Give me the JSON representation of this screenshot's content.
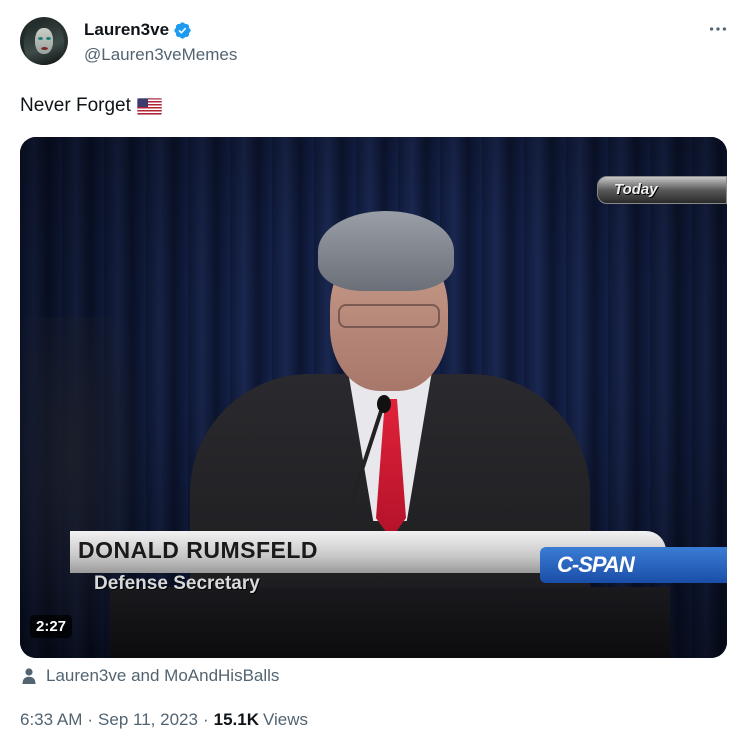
{
  "author": {
    "display_name": "Lauren3ve",
    "handle": "@Lauren3veMemes",
    "verified": true
  },
  "tweet": {
    "text": "Never Forget",
    "emoji": "us-flag"
  },
  "media": {
    "overlay_today": "Today",
    "lower_third_name": "DONALD RUMSFELD",
    "lower_third_title": "Defense Secretary",
    "network_logo": "C-SPAN",
    "duration": "2:27"
  },
  "engagement": {
    "text": "Lauren3ve and MoAndHisBalls"
  },
  "meta": {
    "time": "6:33 AM",
    "date": "Sep 11, 2023",
    "views_count": "15.1K",
    "views_label": "Views"
  },
  "colors": {
    "verified": "#1d9bf0",
    "secondary_text": "#536471",
    "primary_text": "#0f1419"
  }
}
